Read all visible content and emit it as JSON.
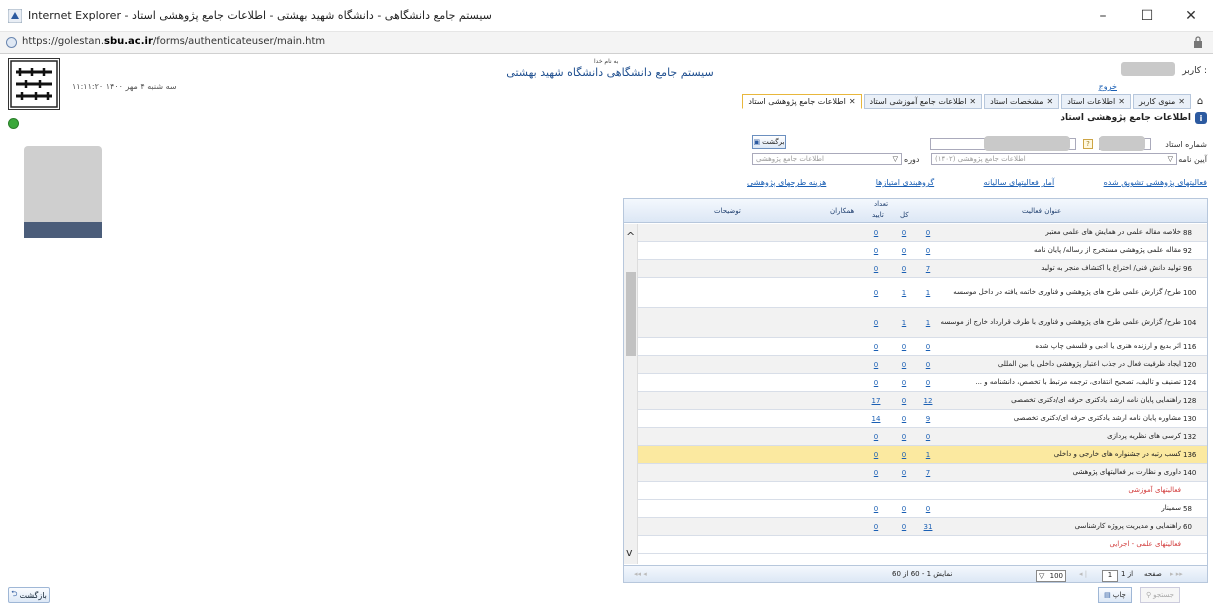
{
  "window": {
    "title": "Internet Explorer - سیستم جامع دانشگاهی - دانشگاه شهید بهشتی - اطلاعات جامع پژوهشی استاد",
    "url_prefix": "https://golestan.",
    "url_domain": "sbu.ac.ir",
    "url_suffix": "/forms/authenticateuser/main.htm",
    "minimize": "–",
    "maximize": "☐",
    "close": "✕"
  },
  "header": {
    "bismillah": "به نام خدا",
    "system_title": "سیستم جامع دانشگاهی   دانشگاه شهید بهشتی",
    "datetime": "۱۱:۱۱:۲۰  سه شنبه ۴ مهر ۱۴۰۰",
    "user_label": "کاربر :",
    "logout": "خروج"
  },
  "logo": {
    "text": "دانشگاه شهید بهشتی"
  },
  "tabs": [
    {
      "label": "منوی کاربر",
      "active": false
    },
    {
      "label": "اطلاعات استاد",
      "active": false
    },
    {
      "label": "مشخصات استاد",
      "active": false
    },
    {
      "label": "اطلاعات جامع آموزشی استاد",
      "active": false
    },
    {
      "label": "اطلاعات جامع پژوهشی استاد",
      "active": true
    }
  ],
  "form": {
    "title": "اطلاعات جامع پژوهشی استاد",
    "professor_number_label": "شماره استاد",
    "regulation_label": "آیین نامه",
    "regulation_value": "اطلاعات جامع پژوهشی (۱۴۰۲)",
    "period_label": "دوره",
    "period_value": "اطلاعات جامع پژوهشی",
    "return_button": "برگشت",
    "help": "?"
  },
  "links": [
    "هزینه طرحهای پژوهشی",
    "گروهبندی امتیازها",
    "آمار فعالیتهای سالیانه",
    "فعالیتهای پژوهشی تشویق شده"
  ],
  "grid": {
    "headers": {
      "title": "عنوان فعالیت",
      "count": "تعداد",
      "total": "کل",
      "approved": "تایید",
      "collaborators": "همکاران",
      "description": "توضیحات"
    },
    "rows": [
      {
        "num": "88",
        "title": "خلاصه مقاله علمی در همایش های علمی معتبر",
        "total": "0",
        "approved": "0",
        "collab": "0",
        "type": "alt"
      },
      {
        "num": "92",
        "title": "مقاله علمی پژوهشی مستخرج از رساله/ پایان نامه",
        "total": "0",
        "approved": "0",
        "collab": "0",
        "type": ""
      },
      {
        "num": "96",
        "title": "تولید دانش فنی/ اختراع یا اکتشاف منجر به تولید",
        "total": "7",
        "approved": "0",
        "collab": "0",
        "type": "alt"
      },
      {
        "num": "100",
        "title": "طرح/ گزارش علمی طرح های پژوهشی و فناوری خاتمه یافته در داخل موسسه",
        "total": "1",
        "approved": "1",
        "collab": "0",
        "type": "",
        "tall": true
      },
      {
        "num": "104",
        "title": "طرح/ گزارش علمی طرح های پژوهشی و فناوری با طرف قرارداد خارج از موسسه",
        "total": "1",
        "approved": "1",
        "collab": "0",
        "type": "alt",
        "tall": true
      },
      {
        "num": "116",
        "title": "اثر بدیع و ارزنده هنری یا ادبی و فلسفی چاپ شده",
        "total": "0",
        "approved": "0",
        "collab": "0",
        "type": ""
      },
      {
        "num": "120",
        "title": "ایجاد ظرفیت فعال در جذب اعتبار پژوهشی داخلی یا بین المللی",
        "total": "0",
        "approved": "0",
        "collab": "0",
        "type": "alt"
      },
      {
        "num": "124",
        "title": "تصنیف و تالیف، تصحیح انتقادی، ترجمه مرتبط با تخصص، دانشنامه و ...",
        "total": "0",
        "approved": "0",
        "collab": "0",
        "type": ""
      },
      {
        "num": "128",
        "title": "راهنمایی پایان نامه ارشد یادکتری حرفه ای/دکتری تخصصی",
        "total": "12",
        "approved": "0",
        "collab": "17",
        "type": "alt"
      },
      {
        "num": "130",
        "title": "مشاوره پایان نامه ارشد یادکتری حرفه ای/دکتری تخصصی",
        "total": "9",
        "approved": "0",
        "collab": "14",
        "type": ""
      },
      {
        "num": "132",
        "title": "کرسی های نظریه پردازی",
        "total": "0",
        "approved": "0",
        "collab": "0",
        "type": "alt"
      },
      {
        "num": "136",
        "title": "کسب رتبه در جشنواره های خارجی و داخلی",
        "total": "1",
        "approved": "0",
        "collab": "0",
        "type": "highlight"
      },
      {
        "num": "140",
        "title": "داوری و نظارت بر فعالیتهای پژوهشی",
        "total": "7",
        "approved": "0",
        "collab": "0",
        "type": "alt"
      },
      {
        "num": "",
        "title": "فعالیتهای آموزشی",
        "total": "",
        "approved": "",
        "collab": "",
        "type": "cat"
      },
      {
        "num": "58",
        "title": "سمینار",
        "total": "0",
        "approved": "0",
        "collab": "0",
        "type": ""
      },
      {
        "num": "60",
        "title": "راهنمایی و مدیریت پروژه کارشناسی",
        "total": "31",
        "approved": "0",
        "collab": "0",
        "type": "alt"
      },
      {
        "num": "",
        "title": "فعالیتهای علمی - اجرایی",
        "total": "",
        "approved": "",
        "collab": "",
        "type": "cat"
      }
    ],
    "footer": {
      "showing": "نمایش 1 - 60 از 60",
      "page_label": "صفحه",
      "page_value": "1",
      "of": "از 1",
      "page_size": "100"
    }
  },
  "bottom": {
    "back": "بازگشت",
    "print": "چاپ",
    "search": "جستجو"
  }
}
